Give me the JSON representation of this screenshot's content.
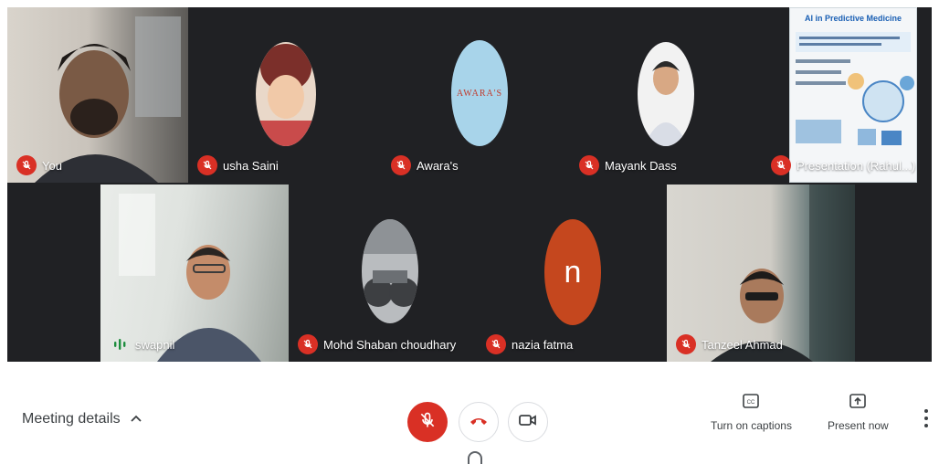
{
  "participants": {
    "you": "You",
    "usha": "usha Saini",
    "awaras": "Awara's",
    "mayank": "Mayank Dass",
    "presentation": "Presentation (Rahul...)",
    "swapnil": "swapnil",
    "mohd": "Mohd Shaban choudhary",
    "nazia": "nazia fatma",
    "tanzeel": "Tanzeel Ahmad"
  },
  "awaras_logo_text": "AWARA'S",
  "nazia_initial": "n",
  "slide": {
    "title": "AI in Predictive Medicine"
  },
  "bottom_bar": {
    "meeting_details": "Meeting details",
    "captions_label": "Turn on captions",
    "present_label": "Present now"
  },
  "icons": {
    "mic": "mic-off-icon",
    "hangup": "call-end-icon",
    "camera": "videocam-icon",
    "captions": "closed-caption-icon",
    "present": "present-to-all-icon",
    "more": "more-vert-icon",
    "chevron": "chevron-up-icon"
  },
  "colors": {
    "tile_bg": "#202124",
    "mute_red": "#d93025",
    "awaras_bg": "#a8d4ea",
    "nazia_bg": "#c5471e"
  }
}
